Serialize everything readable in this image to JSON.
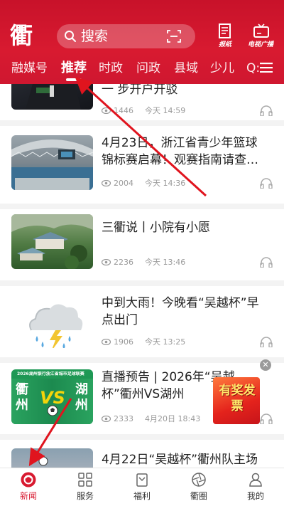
{
  "header": {
    "logo_text": "衢",
    "search_placeholder": "搜索",
    "newspaper_label": "报纸",
    "tv_label": "电视广播"
  },
  "tabs": [
    {
      "label": "融媒号"
    },
    {
      "label": "推荐",
      "active": true
    },
    {
      "label": "时政"
    },
    {
      "label": "问政"
    },
    {
      "label": "县域"
    },
    {
      "label": "少儿"
    },
    {
      "label": "Q:"
    }
  ],
  "feed": [
    {
      "title": "一 步开户开驳",
      "views": "1446",
      "time": "今天 14:59"
    },
    {
      "title": "4月23日，浙江省青少年篮球锦标赛启幕！观赛指南请查…",
      "views": "2004",
      "time": "今天 14:36"
    },
    {
      "title": "三衢说丨小院有小愿",
      "views": "2236",
      "time": "今天 13:46"
    },
    {
      "title": "中到大雨！今晚看“吴越杯”早点出门",
      "views": "1906",
      "time": "今天 13:25"
    },
    {
      "title": "直播预告 | 2026年“吴越杯”衢州VS湖州",
      "views": "2333",
      "time": "4月20日 18:43",
      "thumb_text": {
        "left": "衢州",
        "vs": "VS",
        "right": "湖州",
        "banner": "2026湖州银行浙江省城市足球联赛"
      }
    },
    {
      "title": "4月22日“吴越杯”衢州队主场",
      "views": "",
      "time": ""
    }
  ],
  "ad": {
    "text": "有奖发票"
  },
  "bottom_nav": [
    {
      "label": "新闻",
      "active": true
    },
    {
      "label": "服务"
    },
    {
      "label": "福利"
    },
    {
      "label": "衢圈"
    },
    {
      "label": "我的"
    }
  ],
  "colors": {
    "brand_red": "#d81a30",
    "meta_gray": "#9a9a9a"
  }
}
